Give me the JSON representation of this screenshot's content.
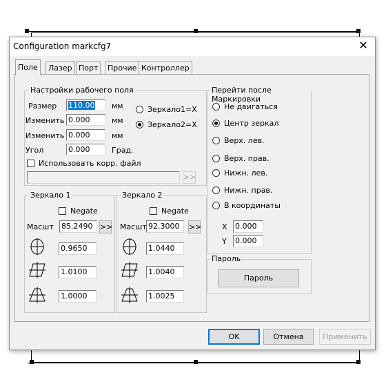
{
  "dialog": {
    "title": "Configuration markcfg7"
  },
  "tabs": [
    "Поле",
    "Лазер",
    "Порт",
    "Прочие",
    "Контроллер"
  ],
  "field_settings": {
    "title": "Настройки рабочего поля",
    "size_label": "Размер",
    "size_value": "110.00",
    "size_unit": "мм",
    "change1_label": "Изменить",
    "change1_value": "0.000",
    "change1_unit": "мм",
    "change2_label": "Изменить",
    "change2_value": "0.000",
    "change2_unit": "мм",
    "angle_label": "Угол",
    "angle_value": "0.000",
    "angle_unit": "Град.",
    "mirror1x_label": "Зеркало1=X",
    "mirror2x_label": "Зеркало2=X",
    "use_corr_label": "Использовать корр. файл",
    "corr_file_value": "",
    "browse_label": ">>"
  },
  "mirror1": {
    "title": "Зеркало 1",
    "negate_label": "Negate",
    "scale_label": "Масшт",
    "scale_value": "85.2490",
    "scale_btn": ">>",
    "v1": "0.9650",
    "v2": "1.0100",
    "v3": "1.0000"
  },
  "mirror2": {
    "title": "Зеркало 2",
    "negate_label": "Negate",
    "scale_label": "Масшт",
    "scale_value": "92.3000",
    "scale_btn": ">>",
    "v1": "1.0440",
    "v2": "1.0040",
    "v3": "1.0025"
  },
  "after_mark": {
    "title": "Перейти после Маркировки",
    "options": [
      "Не двигаться",
      "Центр зеркал",
      "Верх. лев.",
      "Верх. прав.",
      "Нижн. лев.",
      "Нижн. прав.",
      "В координаты"
    ],
    "selected": "Центр зеркал",
    "x_label": "X",
    "x_value": "0.000",
    "y_label": "Y",
    "y_value": "0.000"
  },
  "password": {
    "title": "Пароль",
    "button": "Пароль"
  },
  "footer": {
    "ok": "OK",
    "cancel": "Отмена",
    "apply": "Применить"
  }
}
